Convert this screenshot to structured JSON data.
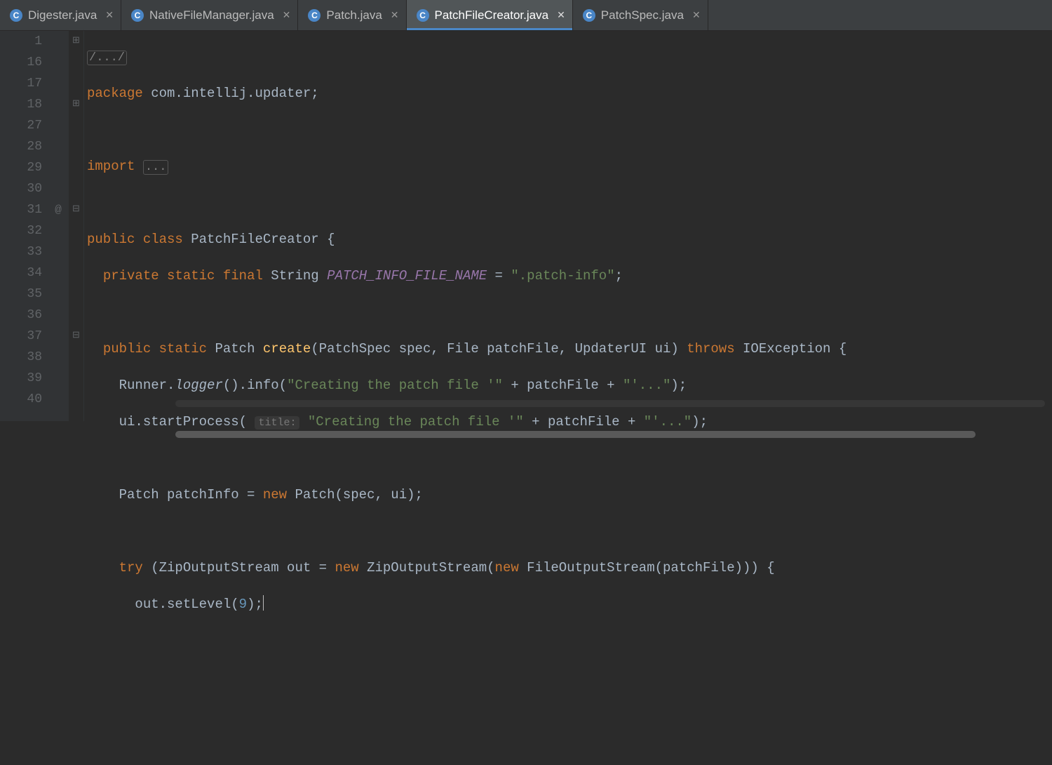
{
  "tabs": [
    {
      "label": "Digester.java",
      "active": false
    },
    {
      "label": "NativeFileManager.java",
      "active": false
    },
    {
      "label": "Patch.java",
      "active": false
    },
    {
      "label": "PatchFileCreator.java",
      "active": true
    },
    {
      "label": "PatchSpec.java",
      "active": false
    }
  ],
  "gutter": {
    "lines": [
      "1",
      "16",
      "17",
      "18",
      "27",
      "28",
      "29",
      "30",
      "31",
      "32",
      "33",
      "34",
      "35",
      "36",
      "37",
      "38",
      "39",
      "40"
    ],
    "annotations": {
      "31": "@"
    },
    "folds": {
      "1": "⊞",
      "18": "⊞",
      "31": "⊟",
      "37": "⊟"
    }
  },
  "code": {
    "l1": {
      "fold": "/.../"
    },
    "l16": {
      "kw": "package",
      "rest": " com.intellij.updater;"
    },
    "l18": {
      "kw": "import",
      "fold": "..."
    },
    "l28_a": "public",
    "l28_b": "class",
    "l28_c": " PatchFileCreator {",
    "l29_a": "private",
    "l29_b": "static",
    "l29_c": "final",
    "l29_d": " String ",
    "l29_e": "PATCH_INFO_FILE_NAME",
    "l29_f": " = ",
    "l29_g": "\".patch-info\"",
    "l29_h": ";",
    "l31_a": "public",
    "l31_b": "static",
    "l31_c": " Patch ",
    "l31_d": "create",
    "l31_e": "(PatchSpec spec, File patchFile, UpdaterUI ui) ",
    "l31_f": "throws",
    "l31_g": " IOException {",
    "l32_a": "Runner.",
    "l32_b": "logger",
    "l32_c": "().info(",
    "l32_d": "\"Creating the patch file '\"",
    "l32_e": " + patchFile + ",
    "l32_f": "\"'...\"",
    "l32_g": ");",
    "l33_a": "ui.startProcess( ",
    "l33_hint": "title:",
    "l33_b": " ",
    "l33_c": "\"Creating the patch file '\"",
    "l33_d": " + patchFile + ",
    "l33_e": "\"'...\"",
    "l33_f": ");",
    "l35_a": "Patch patchInfo = ",
    "l35_b": "new",
    "l35_c": " Patch(spec, ui);",
    "l37_a": "try",
    "l37_b": " (ZipOutputStream out = ",
    "l37_c": "new",
    "l37_d": " ZipOutputStream(",
    "l37_e": "new",
    "l37_f": " FileOutputStream(patchFile))) {",
    "l38_a": "out.setLevel(",
    "l38_b": "9",
    "l38_c": ");"
  },
  "breadcrumb": [
    "",
    ""
  ]
}
